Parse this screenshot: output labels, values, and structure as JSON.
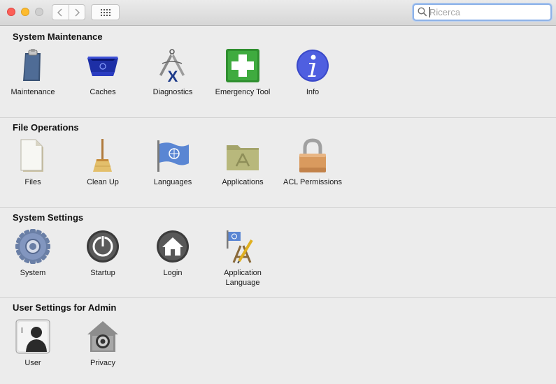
{
  "window": {
    "traffic_lights": {
      "close": "#fc5f57",
      "minimize": "#fdbb2e",
      "zoom": "#cfcfcf"
    }
  },
  "toolbar": {
    "back_icon": "chevron-left-icon",
    "forward_icon": "chevron-right-icon",
    "show_all_icon": "grid-icon"
  },
  "search": {
    "placeholder": "Ricerca",
    "value": ""
  },
  "sections": {
    "system_maintenance": {
      "title": "System Maintenance",
      "items": [
        {
          "label": "Maintenance",
          "icon": "clipboard-icon"
        },
        {
          "label": "Caches",
          "icon": "bin-icon"
        },
        {
          "label": "Diagnostics",
          "icon": "caliper-icon"
        },
        {
          "label": "Emergency Tool",
          "icon": "first-aid-icon"
        },
        {
          "label": "Info",
          "icon": "info-icon"
        }
      ]
    },
    "file_operations": {
      "title": "File Operations",
      "items": [
        {
          "label": "Files",
          "icon": "document-icon"
        },
        {
          "label": "Clean Up",
          "icon": "broom-icon"
        },
        {
          "label": "Languages",
          "icon": "un-flag-icon"
        },
        {
          "label": "Applications",
          "icon": "applications-folder-icon"
        },
        {
          "label": "ACL Permissions",
          "icon": "padlock-icon"
        }
      ]
    },
    "system_settings": {
      "title": "System Settings",
      "items": [
        {
          "label": "System",
          "icon": "gear-icon"
        },
        {
          "label": "Startup",
          "icon": "power-icon"
        },
        {
          "label": "Login",
          "icon": "home-icon"
        },
        {
          "label": "Application\nLanguage",
          "label_line1": "Application",
          "label_line2": "Language",
          "icon": "app-language-icon"
        }
      ]
    },
    "user_settings": {
      "title": "User Settings for Admin",
      "items": [
        {
          "label": "User",
          "icon": "user-silhouette-icon"
        },
        {
          "label": "Privacy",
          "icon": "privacy-house-icon"
        }
      ]
    }
  }
}
